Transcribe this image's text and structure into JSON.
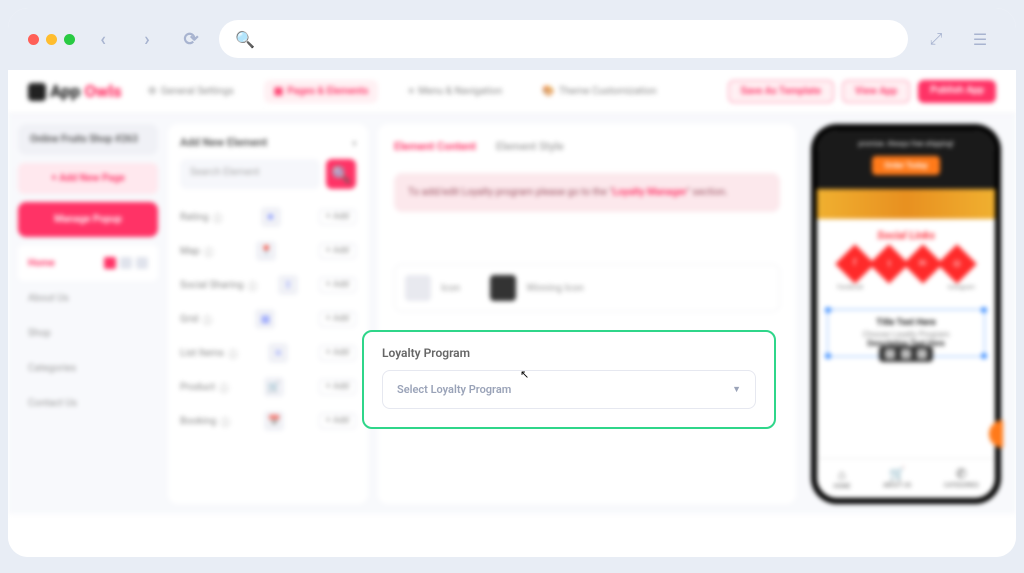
{
  "browser": {
    "search_placeholder": ""
  },
  "brand": {
    "name_pre": "App",
    "name_accent": "Owls"
  },
  "topnav": {
    "general": "General Settings",
    "pages": "Pages & Elements",
    "menu": "Menu & Navigation",
    "theme": "Theme Customization"
  },
  "top_actions": {
    "save_template": "Save As Template",
    "view_app": "View App",
    "publish": "Publish App"
  },
  "sidebar": {
    "shop_title": "Online Fruits Shop #263",
    "add_page": "+ Add New Page",
    "manage_popup": "Manage Popup",
    "pages": [
      "Home",
      "About Us",
      "Shop",
      "Categories",
      "Contact Us"
    ]
  },
  "elements_panel": {
    "title": "Add New Element",
    "search_placeholder": "Search Element",
    "items": [
      "Rating",
      "Map",
      "Social Sharing",
      "Grid",
      "List Items",
      "Product",
      "Booking"
    ],
    "add_label": "+ Add"
  },
  "editor": {
    "tab_content": "Element Content",
    "tab_style": "Element Style",
    "info_pre": "To add/edit Loyalty program please go to the \"",
    "info_link": "Loyalty Manager",
    "info_post": "\" section.",
    "icon_label_1": "Icon",
    "icon_label_2": "Winning Icon"
  },
  "loyalty": {
    "title": "Loyalty Program",
    "placeholder": "Select Loyalty Program"
  },
  "preview": {
    "banner_line": "promise. Always free shipping!",
    "cta": "Order Today",
    "social_title": "Social Links",
    "socials": [
      "Facebook",
      "",
      "",
      "Instagram"
    ],
    "section_title": "Title Text Here",
    "section_sub": "Choose Loyalty Program",
    "section_desc": "Description Text Here",
    "nav": {
      "home": "HOME",
      "about": "ABOUT US",
      "categories": "CATEGORIES"
    }
  }
}
